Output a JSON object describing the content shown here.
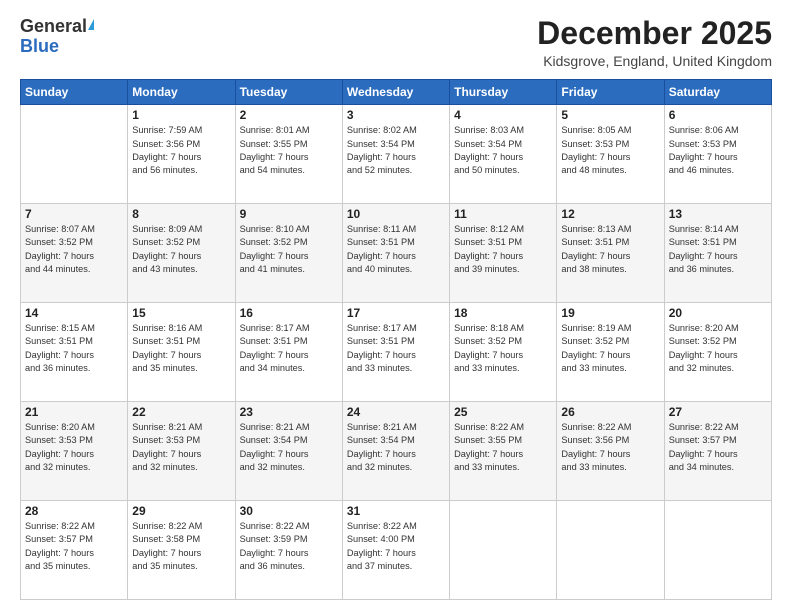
{
  "header": {
    "logo_general": "General",
    "logo_blue": "Blue",
    "month_title": "December 2025",
    "location": "Kidsgrove, England, United Kingdom"
  },
  "days_of_week": [
    "Sunday",
    "Monday",
    "Tuesday",
    "Wednesday",
    "Thursday",
    "Friday",
    "Saturday"
  ],
  "weeks": [
    [
      {
        "day": "",
        "info": ""
      },
      {
        "day": "1",
        "info": "Sunrise: 7:59 AM\nSunset: 3:56 PM\nDaylight: 7 hours\nand 56 minutes."
      },
      {
        "day": "2",
        "info": "Sunrise: 8:01 AM\nSunset: 3:55 PM\nDaylight: 7 hours\nand 54 minutes."
      },
      {
        "day": "3",
        "info": "Sunrise: 8:02 AM\nSunset: 3:54 PM\nDaylight: 7 hours\nand 52 minutes."
      },
      {
        "day": "4",
        "info": "Sunrise: 8:03 AM\nSunset: 3:54 PM\nDaylight: 7 hours\nand 50 minutes."
      },
      {
        "day": "5",
        "info": "Sunrise: 8:05 AM\nSunset: 3:53 PM\nDaylight: 7 hours\nand 48 minutes."
      },
      {
        "day": "6",
        "info": "Sunrise: 8:06 AM\nSunset: 3:53 PM\nDaylight: 7 hours\nand 46 minutes."
      }
    ],
    [
      {
        "day": "7",
        "info": "Sunrise: 8:07 AM\nSunset: 3:52 PM\nDaylight: 7 hours\nand 44 minutes."
      },
      {
        "day": "8",
        "info": "Sunrise: 8:09 AM\nSunset: 3:52 PM\nDaylight: 7 hours\nand 43 minutes."
      },
      {
        "day": "9",
        "info": "Sunrise: 8:10 AM\nSunset: 3:52 PM\nDaylight: 7 hours\nand 41 minutes."
      },
      {
        "day": "10",
        "info": "Sunrise: 8:11 AM\nSunset: 3:51 PM\nDaylight: 7 hours\nand 40 minutes."
      },
      {
        "day": "11",
        "info": "Sunrise: 8:12 AM\nSunset: 3:51 PM\nDaylight: 7 hours\nand 39 minutes."
      },
      {
        "day": "12",
        "info": "Sunrise: 8:13 AM\nSunset: 3:51 PM\nDaylight: 7 hours\nand 38 minutes."
      },
      {
        "day": "13",
        "info": "Sunrise: 8:14 AM\nSunset: 3:51 PM\nDaylight: 7 hours\nand 36 minutes."
      }
    ],
    [
      {
        "day": "14",
        "info": "Sunrise: 8:15 AM\nSunset: 3:51 PM\nDaylight: 7 hours\nand 36 minutes."
      },
      {
        "day": "15",
        "info": "Sunrise: 8:16 AM\nSunset: 3:51 PM\nDaylight: 7 hours\nand 35 minutes."
      },
      {
        "day": "16",
        "info": "Sunrise: 8:17 AM\nSunset: 3:51 PM\nDaylight: 7 hours\nand 34 minutes."
      },
      {
        "day": "17",
        "info": "Sunrise: 8:17 AM\nSunset: 3:51 PM\nDaylight: 7 hours\nand 33 minutes."
      },
      {
        "day": "18",
        "info": "Sunrise: 8:18 AM\nSunset: 3:52 PM\nDaylight: 7 hours\nand 33 minutes."
      },
      {
        "day": "19",
        "info": "Sunrise: 8:19 AM\nSunset: 3:52 PM\nDaylight: 7 hours\nand 33 minutes."
      },
      {
        "day": "20",
        "info": "Sunrise: 8:20 AM\nSunset: 3:52 PM\nDaylight: 7 hours\nand 32 minutes."
      }
    ],
    [
      {
        "day": "21",
        "info": "Sunrise: 8:20 AM\nSunset: 3:53 PM\nDaylight: 7 hours\nand 32 minutes."
      },
      {
        "day": "22",
        "info": "Sunrise: 8:21 AM\nSunset: 3:53 PM\nDaylight: 7 hours\nand 32 minutes."
      },
      {
        "day": "23",
        "info": "Sunrise: 8:21 AM\nSunset: 3:54 PM\nDaylight: 7 hours\nand 32 minutes."
      },
      {
        "day": "24",
        "info": "Sunrise: 8:21 AM\nSunset: 3:54 PM\nDaylight: 7 hours\nand 32 minutes."
      },
      {
        "day": "25",
        "info": "Sunrise: 8:22 AM\nSunset: 3:55 PM\nDaylight: 7 hours\nand 33 minutes."
      },
      {
        "day": "26",
        "info": "Sunrise: 8:22 AM\nSunset: 3:56 PM\nDaylight: 7 hours\nand 33 minutes."
      },
      {
        "day": "27",
        "info": "Sunrise: 8:22 AM\nSunset: 3:57 PM\nDaylight: 7 hours\nand 34 minutes."
      }
    ],
    [
      {
        "day": "28",
        "info": "Sunrise: 8:22 AM\nSunset: 3:57 PM\nDaylight: 7 hours\nand 35 minutes."
      },
      {
        "day": "29",
        "info": "Sunrise: 8:22 AM\nSunset: 3:58 PM\nDaylight: 7 hours\nand 35 minutes."
      },
      {
        "day": "30",
        "info": "Sunrise: 8:22 AM\nSunset: 3:59 PM\nDaylight: 7 hours\nand 36 minutes."
      },
      {
        "day": "31",
        "info": "Sunrise: 8:22 AM\nSunset: 4:00 PM\nDaylight: 7 hours\nand 37 minutes."
      },
      {
        "day": "",
        "info": ""
      },
      {
        "day": "",
        "info": ""
      },
      {
        "day": "",
        "info": ""
      }
    ]
  ]
}
